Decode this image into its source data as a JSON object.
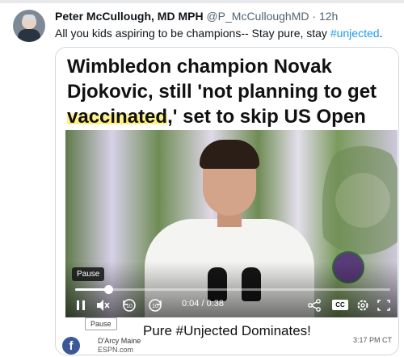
{
  "tweet": {
    "author_name": "Peter McCullough, MD MPH",
    "handle": "@P_McCulloughMD",
    "separator": "·",
    "time": "12h",
    "text_before": "All you kids aspiring to be champions-- Stay pure, stay ",
    "hashtag": "#unjected",
    "text_after": "."
  },
  "card": {
    "headline_part1": "Wimbledon champion Novak Djokovic, still 'not planning to get ",
    "headline_highlight": "vaccinated",
    "headline_part2": ",' set to skip US Open",
    "caption": "Pure #Unjected Dominates!",
    "author": "D'Arcy Maine",
    "source": "ESPN.com",
    "timestamp": "3:17 PM CT",
    "fb_letter": "f"
  },
  "video": {
    "tooltip_top": "Pause",
    "tooltip_bottom": "Pause",
    "current_time": "0:04",
    "duration": "0:38",
    "time_readout": "0:04 / 0:38",
    "progress_fraction": 0.105,
    "cc_label": "CC",
    "skip_back_seconds": "10",
    "skip_forward_seconds": "10"
  },
  "icons": [
    "avatar",
    "pause-icon",
    "mute-icon",
    "rewind-10-icon",
    "forward-10-icon",
    "share-icon",
    "cc-icon",
    "settings-icon",
    "fullscreen-icon",
    "facebook-icon"
  ],
  "colors": {
    "hashtag": "#1d9bf0",
    "highlight": "#fff07a",
    "facebook": "#3b5998"
  }
}
